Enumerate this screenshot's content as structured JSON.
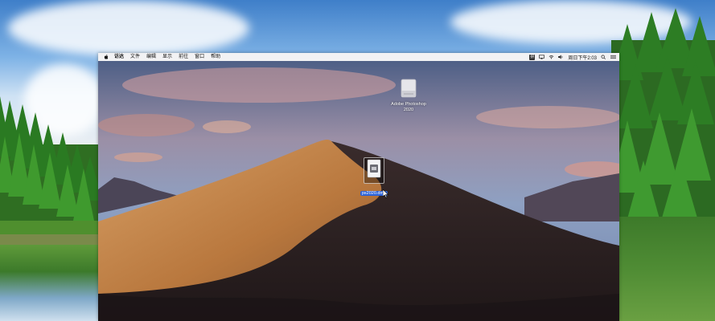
{
  "menubar": {
    "items": [
      "访达",
      "文件",
      "编辑",
      "显示",
      "前往",
      "窗口",
      "帮助"
    ],
    "status": {
      "input_method": "拼",
      "clock": "周日下午2:03"
    }
  },
  "desktop": {
    "icons": [
      {
        "name": "Adobe Photoshop",
        "subtitle": "2020",
        "kind": "mounted-volume"
      },
      {
        "name": "ps2020.dmg",
        "kind": "disk-image",
        "selected": true
      }
    ]
  },
  "colors": {
    "selection": "#2a62d9",
    "menubar": "#f2f2f4"
  }
}
